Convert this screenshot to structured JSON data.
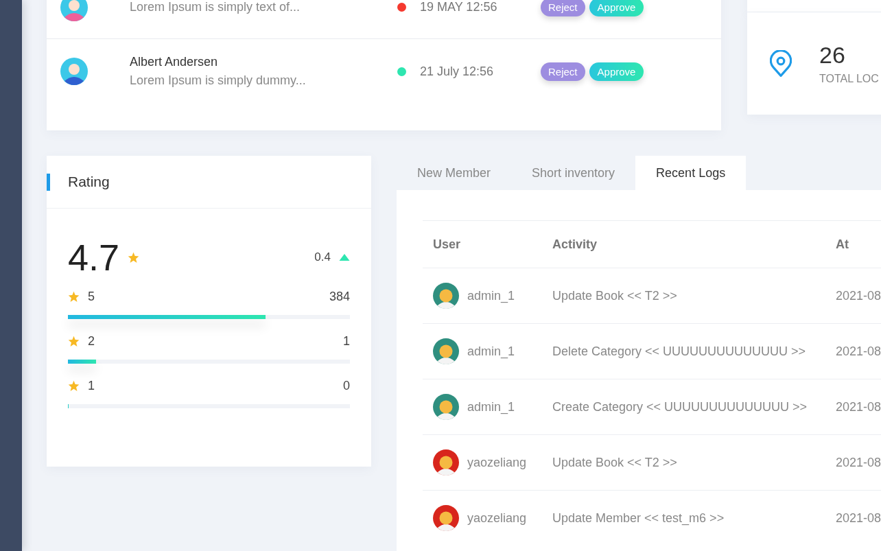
{
  "requests": [
    {
      "message": "Lorem Ipsum is simply text of...",
      "color": "#f5392f",
      "time": "19 MAY 12:56",
      "actions": [
        "Reject",
        "Approve"
      ]
    },
    {
      "name": "Albert Andersen",
      "message": "Lorem Ipsum is simply dummy...",
      "color": "#2ee6b0",
      "time": "21 July 12:56",
      "actions": [
        "Reject",
        "Approve"
      ]
    }
  ],
  "stat": {
    "value": "26",
    "label": "TOTAL LOC"
  },
  "rating": {
    "title": "Rating",
    "score": "4.7",
    "change": "0.4",
    "rows": [
      {
        "stars": "5",
        "count": "384",
        "level": 0.7
      },
      {
        "stars": "2",
        "count": "1",
        "level": 0.1
      },
      {
        "stars": "1",
        "count": "0",
        "level": 0
      }
    ]
  },
  "tabs": [
    {
      "label": "New Member",
      "selected": false
    },
    {
      "label": "Short inventory",
      "selected": false
    },
    {
      "label": "Recent Logs",
      "selected": true
    }
  ],
  "logs": {
    "columns": [
      "User",
      "Activity",
      "At"
    ],
    "rows": [
      {
        "user": "admin_1",
        "color": "#2f8f7f",
        "activity": "Update Book << T2 >>",
        "at": "2021-08"
      },
      {
        "user": "admin_1",
        "color": "#2f8f7f",
        "activity": "Delete Category << UUUUUUUUUUUUUU >>",
        "at": "2021-08"
      },
      {
        "user": "admin_1",
        "color": "#2f8f7f",
        "activity": "Create Category << UUUUUUUUUUUUUU >>",
        "at": "2021-08"
      },
      {
        "user": "yaozeliang",
        "color": "#d8261c",
        "activity": "Update Book << T2 >>",
        "at": "2021-08"
      },
      {
        "user": "yaozeliang",
        "color": "#d8261c",
        "activity": "Update Member << test_m6 >>",
        "at": "2021-08"
      }
    ]
  }
}
